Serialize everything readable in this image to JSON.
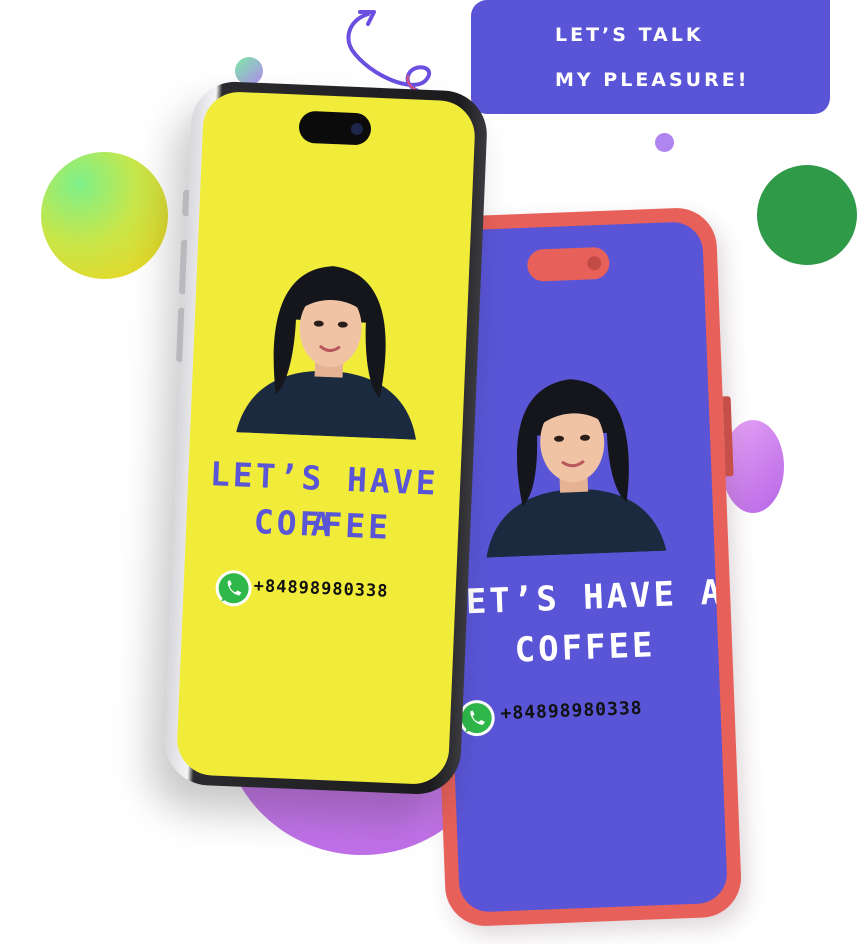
{
  "banner": {
    "line1": "LET’S TALK",
    "line2": "MY PLEASURE!"
  },
  "phone_front": {
    "screen_color": "#f1ec39",
    "title_line1": "LET’S HAVE A",
    "title_line2": "COFFEE",
    "phone_number": "+84898980338",
    "icon": "whatsapp-icon"
  },
  "phone_back": {
    "screen_color": "#5a55d6",
    "frame_color": "#e7615a",
    "title_line1": "LET’S HAVE A",
    "title_line2": "COFFEE",
    "phone_number": "+84898980338",
    "icon": "whatsapp-icon"
  },
  "colors": {
    "accent_purple": "#5a55d6",
    "green": "#2f9a47",
    "coral": "#e7615a",
    "yellow": "#f1ec39"
  }
}
